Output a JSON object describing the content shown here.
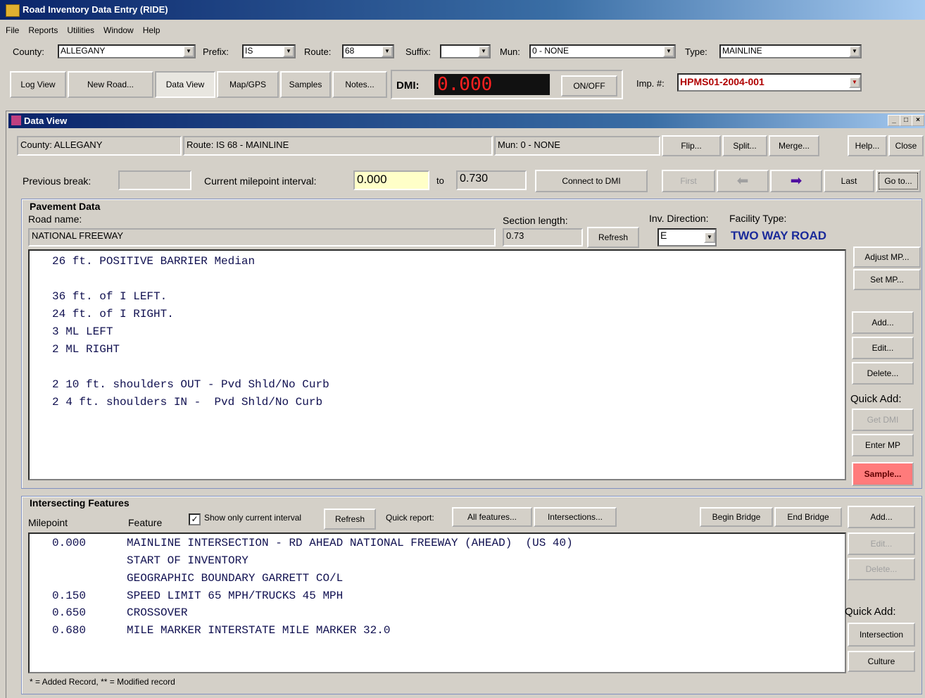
{
  "app": {
    "title": "Road Inventory Data Entry (RIDE)"
  },
  "menu": [
    "File",
    "Reports",
    "Utilities",
    "Window",
    "Help"
  ],
  "filters": {
    "county_label": "County:",
    "county_value": "ALLEGANY",
    "prefix_label": "Prefix:",
    "prefix_value": "IS",
    "route_label": "Route:",
    "route_value": "68",
    "suffix_label": "Suffix:",
    "suffix_value": "",
    "mun_label": "Mun:",
    "mun_value": "0 - NONE",
    "type_label": "Type:",
    "type_value": "MAINLINE"
  },
  "toolbar": {
    "log_view": "Log View",
    "new_road": "New Road...",
    "data_view": "Data View",
    "map_gps": "Map/GPS",
    "samples": "Samples",
    "notes": "Notes...",
    "dmi_label": "DMI:",
    "dmi_value": "0.000",
    "on_off": "ON/OFF",
    "imp_label": "Imp. #:",
    "imp_value": "HPMS01-2004-001"
  },
  "dataview": {
    "title": "Data View",
    "county_label": "County:",
    "county_value": "ALLEGANY",
    "route_label": "Route:",
    "route_value": "IS 68 - MAINLINE",
    "mun_label": "Mun:",
    "mun_value": "0 - NONE",
    "flip": "Flip...",
    "split": "Split...",
    "merge": "Merge...",
    "help": "Help...",
    "close": "Close",
    "prev_break_label": "Previous break:",
    "prev_break_value": "",
    "interval_label": "Current milepoint interval:",
    "interval_from": "0.000",
    "to_label": "to",
    "interval_to": "0.730",
    "connect_dmi": "Connect to DMI",
    "first": "First",
    "last": "Last",
    "goto": "Go to..."
  },
  "pavement": {
    "group_title": "Pavement Data",
    "road_name_label": "Road name:",
    "road_name_value": "NATIONAL FREEWAY",
    "section_length_label": "Section length:",
    "section_length_value": "0.73",
    "refresh": "Refresh",
    "inv_direction_label": "Inv. Direction:",
    "inv_direction_value": "E",
    "facility_type_label": "Facility Type:",
    "facility_type_value": "TWO WAY ROAD",
    "lines": [
      "26 ft. POSITIVE BARRIER Median",
      "",
      "36 ft. of I LEFT.",
      "24 ft. of I RIGHT.",
      "3 ML LEFT",
      "2 ML RIGHT",
      "",
      "2 10 ft. shoulders OUT - Pvd Shld/No Curb",
      "2 4 ft. shoulders IN -  Pvd Shld/No Curb"
    ],
    "side": {
      "adjust_mp": "Adjust MP...",
      "set_mp": "Set MP...",
      "add": "Add...",
      "edit": "Edit...",
      "delete": "Delete...",
      "quick_add": "Quick Add:",
      "get_dmi": "Get DMI",
      "enter_mp": "Enter MP",
      "sample": "Sample..."
    }
  },
  "features": {
    "group_title": "Intersecting Features",
    "milepoint_header": "Milepoint",
    "feature_header": "Feature",
    "show_only_label": "Show only current interval",
    "show_only_checked": true,
    "refresh": "Refresh",
    "quick_report_label": "Quick report:",
    "all_features": "All features...",
    "intersections": "Intersections...",
    "begin_bridge": "Begin Bridge",
    "end_bridge": "End Bridge",
    "rows": [
      {
        "mp": "0.000",
        "feature": "MAINLINE INTERSECTION - RD AHEAD NATIONAL FREEWAY (AHEAD)  (US 40)"
      },
      {
        "mp": "",
        "feature": "START OF INVENTORY"
      },
      {
        "mp": "",
        "feature": "GEOGRAPHIC BOUNDARY GARRETT CO/L"
      },
      {
        "mp": "0.150",
        "feature": "SPEED LIMIT 65 MPH/TRUCKS 45 MPH"
      },
      {
        "mp": "0.650",
        "feature": "CROSSOVER"
      },
      {
        "mp": "0.680",
        "feature": "MILE MARKER INTERSTATE MILE MARKER 32.0"
      }
    ],
    "side": {
      "add": "Add...",
      "edit": "Edit...",
      "delete": "Delete...",
      "quick_add": "Quick Add:",
      "intersection": "Intersection",
      "culture": "Culture"
    },
    "status": "* = Added Record, ** = Modified record"
  },
  "colors": {
    "title_blue": "#0a246a",
    "dmi_red": "#ff2020",
    "sample_btn": "#ff7b7b",
    "facility_blue": "#1a2a9a",
    "imp_red": "#b00000"
  }
}
